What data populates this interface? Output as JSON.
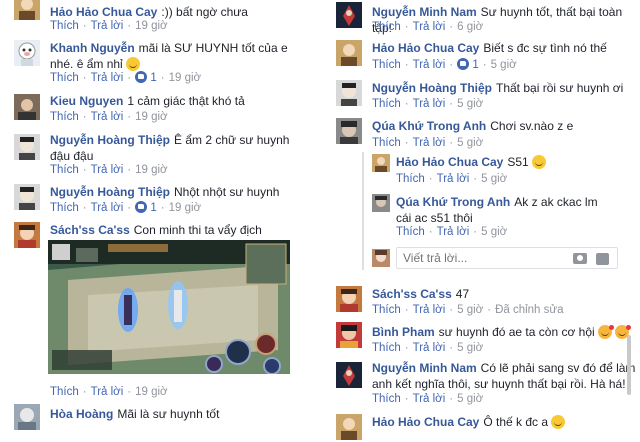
{
  "left": {
    "comments": [
      {
        "name": "Hảo Hảo Chua Cay",
        "text": ":)) bất ngờ chưa",
        "like": "Thích",
        "reply": "Trả lời",
        "time": "19 giờ"
      },
      {
        "name": "Khanh Nguyễn",
        "text": "mãi là SƯ HUYNH tốt của e nhé. ê ẩm nhỉ",
        "like": "Thích",
        "reply": "Trả lời",
        "likes": "1",
        "time": "19 giờ"
      },
      {
        "name": "Kieu Nguyen",
        "text": "1 cảm giác thật khó tả",
        "like": "Thích",
        "reply": "Trả lời",
        "time": "19 giờ"
      },
      {
        "name": "Nguyễn Hoàng Thiệp",
        "text": "Ê ẩm 2 chữ sư huynh đậu đậu",
        "like": "Thích",
        "reply": "Trả lời",
        "time": "19 giờ"
      },
      {
        "name": "Nguyễn Hoàng Thiệp",
        "text": "Nhột nhột sư huynh",
        "like": "Thích",
        "reply": "Trả lời",
        "likes": "1",
        "time": "19 giờ"
      },
      {
        "name": "Sách'ss Ca'ss",
        "text": "Con minh thi ta vẩy địch",
        "like": "Thích",
        "reply": "Trả lời",
        "time": "19 giờ"
      },
      {
        "name": "Hòa Hoàng",
        "text": "Mãi là sư huynh tốt"
      }
    ]
  },
  "right": {
    "comments": [
      {
        "name": "Nguyễn Minh Nam",
        "text": "Sư huynh tốt, thất bại toàn tập!",
        "like": "Thích",
        "reply": "Trả lời",
        "time": "6 giờ"
      },
      {
        "name": "Hảo Hảo Chua Cay",
        "text": "Biết s đc sự tình nó thế",
        "like": "Thích",
        "reply": "Trả lời",
        "likes": "1",
        "time": "5 giờ"
      },
      {
        "name": "Nguyễn Hoàng Thiệp",
        "text": "Thất bại rồi sư huynh ơi",
        "like": "Thích",
        "reply": "Trả lời",
        "time": "5 giờ"
      },
      {
        "name": "Qúa Khứ Trong Anh",
        "text": "Chơi sv.nào z e",
        "like": "Thích",
        "reply": "Trả lời",
        "time": "5 giờ"
      }
    ],
    "replies": [
      {
        "name": "Hảo Hảo Chua Cay",
        "text": "S51",
        "like": "Thích",
        "reply": "Trả lời",
        "time": "5 giờ"
      },
      {
        "name": "Qúa Khứ Trong Anh",
        "text": "Ak z ak ckac lm cái ac s51 thôi",
        "like": "Thích",
        "reply": "Trả lời",
        "time": "5 giờ"
      }
    ],
    "reply_placeholder": "Viết trả lời...",
    "comments2": [
      {
        "name": "Sách'ss Ca'ss",
        "text": "47",
        "like": "Thích",
        "reply": "Trả lời",
        "time": "5 giờ",
        "edited": "Đã chỉnh sửa"
      },
      {
        "name": "Bình Pham",
        "text": "sư huynh đó ae ta còn cơ hội",
        "like": "Thích",
        "reply": "Trả lời",
        "time": "5 giờ"
      },
      {
        "name": "Nguyễn Minh Nam",
        "text": "Có lẽ phải sang sv đó để làm anh kết nghĩa thôi, sư huynh thất bại rồi. Hà há!",
        "like": "Thích",
        "reply": "Trả lời",
        "time": "5 giờ"
      },
      {
        "name": "Hảo Hảo Chua Cay",
        "text": "Ô thế k đc a"
      }
    ]
  },
  "colors": {
    "link": "#4267b2",
    "name": "#365899",
    "meta": "#90949c",
    "text": "#1d2129"
  }
}
